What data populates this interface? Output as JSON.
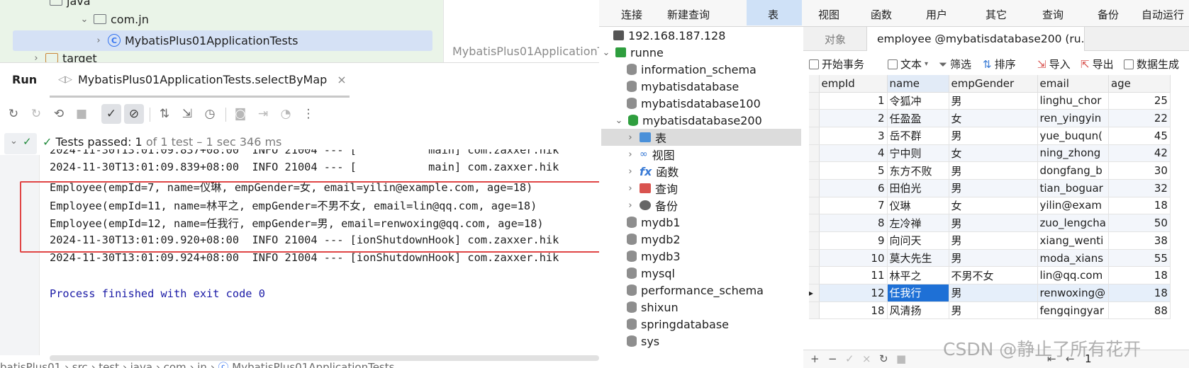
{
  "ide": {
    "project_tree": {
      "items": [
        {
          "label": "java",
          "type": "folder"
        },
        {
          "label": "com.jn",
          "type": "package"
        },
        {
          "label": "MybatisPlus01ApplicationTests",
          "type": "class"
        },
        {
          "label": "target",
          "type": "folder"
        }
      ]
    },
    "editor_tab_label": "MybatisPlus01ApplicationT",
    "run": {
      "title": "Run",
      "tab_label": "MybatisPlus01ApplicationTests.selectByMap",
      "tab_close": "×"
    },
    "status": {
      "passed": "Tests passed:",
      "count": "1",
      "detail": "of 1 test – 1 sec 346 ms"
    },
    "console_lines": [
      "2024-11-30T13:01:09.839+08:00  INFO 21004 --- [           main] com.zaxxer.hik",
      "Employee(empId=7, name=仪琳, empGender=女, email=yilin@example.com, age=18)",
      "Employee(empId=11, name=林平之, empGender=不男不女, email=lin@qq.com, age=18)",
      "Employee(empId=12, name=任我行, empGender=男, email=renwoxing@qq.com, age=18)",
      "2024-11-30T13:01:09.920+08:00  INFO 21004 --- [ionShutdownHook] com.zaxxer.hik",
      "2024-11-30T13:01:09.924+08:00  INFO 21004 --- [ionShutdownHook] com.zaxxer.hik",
      "",
      "Process finished with exit code 0"
    ],
    "console_top_partial": "2024-11-30T13:01:09.837+08:00  INFO 21004 --- [           main] com.zaxxer.hik",
    "breadcrumb": [
      "batisPlus01",
      "src",
      "test",
      "java",
      "com",
      "jn",
      "MybatisPlus01ApplicationTests"
    ]
  },
  "navicat": {
    "topbar": [
      {
        "label": "连接"
      },
      {
        "label": "新建查询"
      },
      {
        "label": "表"
      },
      {
        "label": "视图"
      },
      {
        "label": "函数"
      },
      {
        "label": "用户"
      },
      {
        "label": "其它"
      },
      {
        "label": "查询"
      },
      {
        "label": "备份"
      },
      {
        "label": "自动运行"
      }
    ],
    "connections": {
      "server_ip": "192.168.187.128",
      "connection": "runne",
      "databases": [
        "information_schema",
        "mybatisdatabase",
        "mybatisdatabase100",
        "mybatisdatabase200"
      ],
      "db200_children": [
        "表",
        "视图",
        "函数",
        "查询",
        "备份"
      ],
      "other_databases": [
        "mydb1",
        "mydb2",
        "mydb3",
        "mysql",
        "performance_schema",
        "shixun",
        "springdatabase",
        "sys"
      ]
    },
    "tabs": {
      "objects": "对象",
      "table_tab": "employee @mybatisdatabase200 (ru..."
    },
    "grid_toolbar": [
      "开始事务",
      "文本",
      "筛选",
      "排序",
      "导入",
      "导出",
      "数据生成"
    ],
    "table": {
      "columns": [
        "empId",
        "name",
        "empGender",
        "email",
        "age"
      ],
      "rows": [
        {
          "empId": "1",
          "name": "令狐冲",
          "empGender": "男",
          "email": "linghu_chor",
          "age": "25"
        },
        {
          "empId": "2",
          "name": "任盈盈",
          "empGender": "女",
          "email": "ren_yingyin",
          "age": "22"
        },
        {
          "empId": "3",
          "name": "岳不群",
          "empGender": "男",
          "email": "yue_buqun(",
          "age": "45"
        },
        {
          "empId": "4",
          "name": "宁中则",
          "empGender": "女",
          "email": "ning_zhong",
          "age": "42"
        },
        {
          "empId": "5",
          "name": "东方不败",
          "empGender": "男",
          "email": "dongfang_b",
          "age": "30"
        },
        {
          "empId": "6",
          "name": "田伯光",
          "empGender": "男",
          "email": "tian_boguar",
          "age": "32"
        },
        {
          "empId": "7",
          "name": "仪琳",
          "empGender": "女",
          "email": "yilin@exam",
          "age": "18"
        },
        {
          "empId": "8",
          "name": "左冷禅",
          "empGender": "男",
          "email": "zuo_lengcha",
          "age": "50"
        },
        {
          "empId": "9",
          "name": "向问天",
          "empGender": "男",
          "email": "xiang_wenti",
          "age": "38"
        },
        {
          "empId": "10",
          "name": "莫大先生",
          "empGender": "男",
          "email": "moda_xians",
          "age": "55"
        },
        {
          "empId": "11",
          "name": "林平之",
          "empGender": "不男不女",
          "email": "lin@qq.com",
          "age": "18"
        },
        {
          "empId": "12",
          "name": "任我行",
          "empGender": "男",
          "email": "renwoxing@",
          "age": "18"
        },
        {
          "empId": "18",
          "name": "风清扬",
          "empGender": "男",
          "email": "fengqingyar",
          "age": "88"
        }
      ],
      "current_row_index": 11
    },
    "bottom_bar": {
      "page": "1"
    },
    "watermark": "CSDN @静止了所有花开"
  }
}
